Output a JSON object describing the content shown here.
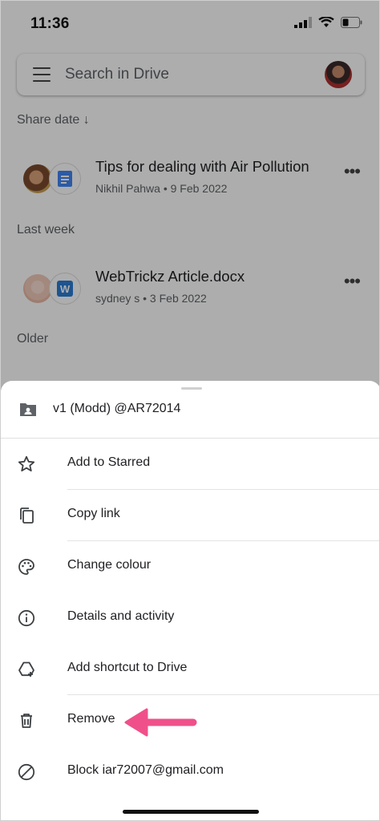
{
  "status_bar": {
    "time": "11:36"
  },
  "search": {
    "placeholder": "Search in Drive"
  },
  "sections": {
    "share_date": "Share date ↓",
    "last_week": "Last week",
    "older": "Older"
  },
  "files": [
    {
      "title": "Tips for dealing with Air Pollution",
      "meta": "Nikhil Pahwa • 9 Feb 2022",
      "type_icon": "docs-icon"
    },
    {
      "title": "WebTrickz Article.docx",
      "meta": "sydney s • 3 Feb 2022",
      "type_icon": "word-icon"
    }
  ],
  "sheet": {
    "header": "v1 (Modd) @AR72014",
    "actions": [
      {
        "label": "Add to Starred",
        "icon": "star-icon"
      },
      {
        "label": "Copy link",
        "icon": "copy-link-icon"
      },
      {
        "label": "Change colour",
        "icon": "palette-icon"
      },
      {
        "label": "Details and activity",
        "icon": "info-icon"
      },
      {
        "label": "Add shortcut to Drive",
        "icon": "add-shortcut-icon"
      },
      {
        "label": "Remove",
        "icon": "trash-icon"
      },
      {
        "label": "Block iar72007@gmail.com",
        "icon": "block-icon"
      }
    ]
  },
  "colors": {
    "accent_arrow": "#f0508a",
    "scrim": "rgba(0,0,0,0.32)"
  }
}
